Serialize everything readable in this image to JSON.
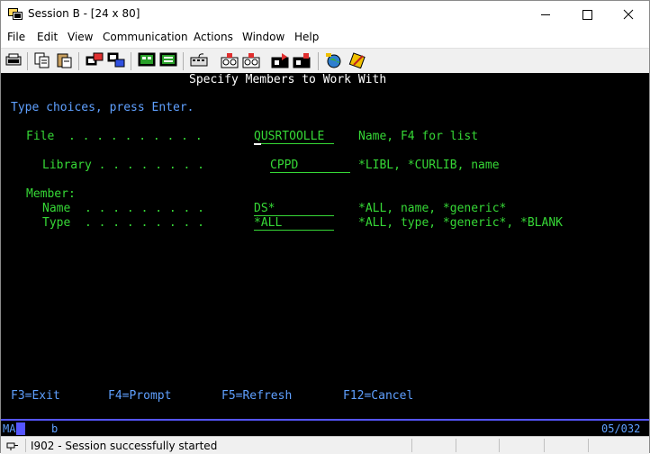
{
  "window": {
    "title": "Session B - [24 x 80]"
  },
  "menu": [
    "File",
    "Edit",
    "View",
    "Communication",
    "Actions",
    "Window",
    "Help"
  ],
  "toolbar_icons": [
    "print-screen-icon",
    "copy-icon",
    "paste-icon",
    "send-icon",
    "receive-icon",
    "display-icon",
    "macro-icon",
    "keyboard-icon",
    "record-macro-icon",
    "play-macro-icon",
    "stop-macro-icon",
    "run-macro-icon",
    "support-icon",
    "edit-macro-icon"
  ],
  "screen": {
    "heading": "Specify Members to Work With",
    "instruction": "Type choices, press Enter.",
    "file": {
      "label": "File  . . . . . . . . . .",
      "value": "QUSRTOOLLE",
      "hint": "Name, F4 for list"
    },
    "library": {
      "label": "Library . . . . . . . .",
      "value": "CPPD",
      "hint": "*LIBL, *CURLIB, name"
    },
    "member_label": "Member:",
    "name": {
      "label": "Name  . . . . . . . . .",
      "value": "DS*",
      "hint": "*ALL, name, *generic*"
    },
    "type": {
      "label": "Type  . . . . . . . . .",
      "value": "*ALL",
      "hint": "*ALL, type, *generic*, *BLANK"
    },
    "fkeys": [
      "F3=Exit",
      "F4=Prompt",
      "F5=Refresh",
      "F12=Cancel"
    ]
  },
  "oia": {
    "mode": "MA",
    "indicator": "b",
    "cursor": "05/032"
  },
  "status": {
    "message": "I902 - Session successfully started"
  },
  "colors": {
    "screen_bg": "#000000",
    "green": "#36d836",
    "blue": "#5fa0ff",
    "white": "#ffffff",
    "oia_line": "#5555ff"
  }
}
